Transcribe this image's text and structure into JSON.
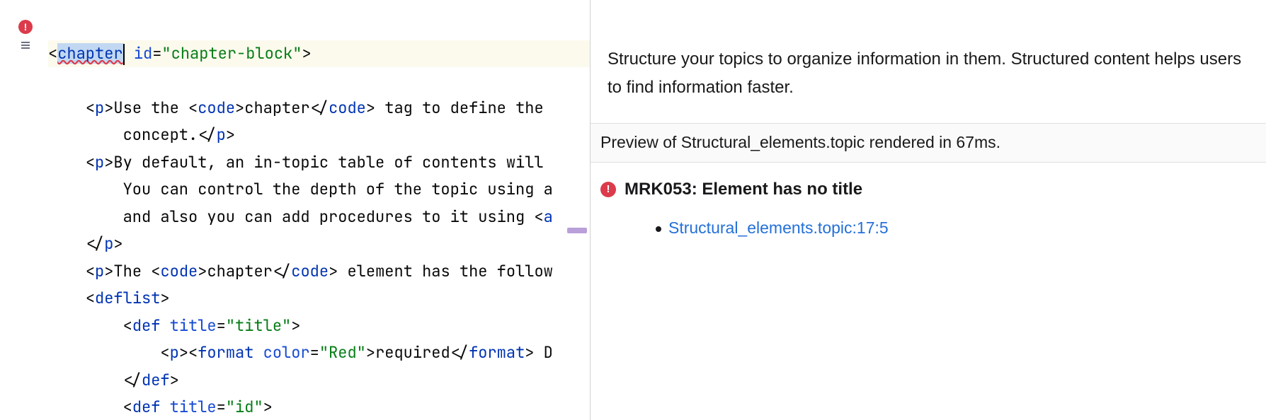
{
  "editor": {
    "tag_open_lt": "<",
    "tag_open_name": "chapter",
    "tag_open_id_attr": "id",
    "tag_open_id_val": "\"chapter-block\"",
    "tag_open_gt": ">",
    "line2": {
      "lt1": "<",
      "p": "p",
      "gt1": ">",
      "txt1": "Use the ",
      "lt2": "<",
      "code": "code",
      "gt2": ">",
      "txt2": "chapter",
      "lt3": "</",
      "code2": "code",
      "gt3": ">",
      "txt3": " tag to define the "
    },
    "line3_txt": "concept.",
    "line3_close": {
      "lt": "</",
      "p": "p",
      "gt": ">"
    },
    "line4": {
      "lt1": "<",
      "p": "p",
      "gt1": ">",
      "txt": "By default, an in-topic table of contents will "
    },
    "line5_txt": "You can control the depth of the topic using a",
    "line6_txt": "and also you can add procedures to it using ",
    "line6_tag": {
      "lt": "<",
      "a": "a"
    },
    "line7": {
      "lt": "</",
      "p": "p",
      "gt": ">"
    },
    "line8": {
      "lt1": "<",
      "p": "p",
      "gt1": ">",
      "txt1": "The ",
      "lt2": "<",
      "code": "code",
      "gt2": ">",
      "txt2": "chapter",
      "lt3": "</",
      "code2": "code",
      "gt3": ">",
      "txt3": " element has the follow"
    },
    "line9": {
      "lt": "<",
      "name": "deflist",
      "gt": ">"
    },
    "line10": {
      "lt": "<",
      "name": "def",
      "attr": "title",
      "val": "\"title\"",
      "gt": ">"
    },
    "line11": {
      "lt1": "<",
      "p": "p",
      "gt1": ">",
      "lt2": "<",
      "fmt": "format",
      "attr": "color",
      "val": "\"Red\"",
      "gt2": ">",
      "txt": "required",
      "lt3": "</",
      "fmt2": "format",
      "gt3": ">",
      "txt2": " D"
    },
    "line12": {
      "lt": "</",
      "name": "def",
      "gt": ">"
    },
    "line13": {
      "lt": "<",
      "name": "def",
      "attr": "title",
      "val": "\"id\"",
      "gt": ">"
    }
  },
  "preview": {
    "paragraph": "Structure your topics to organize information in them. Structured content helps users to find information faster.",
    "status": "Preview of Structural_elements.topic rendered in 67ms.",
    "issue_title": "MRK053: Element has no title",
    "issue_link": "Structural_elements.topic:17:5"
  }
}
